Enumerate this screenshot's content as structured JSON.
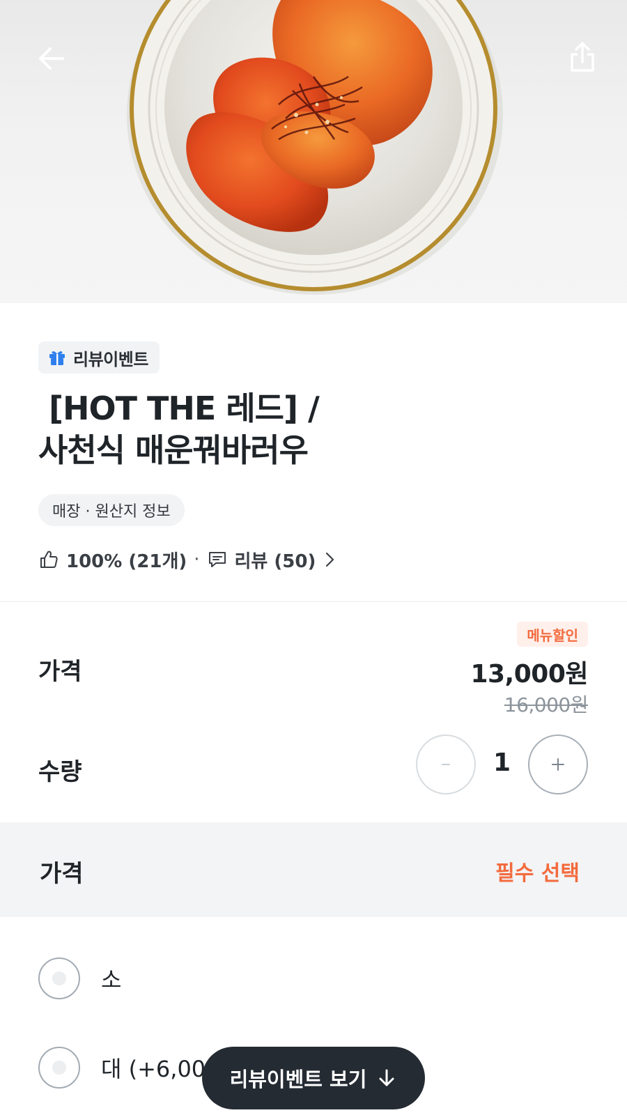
{
  "hero": {
    "image": "spicy-fried-pork-dish-photo",
    "back_icon": "arrow-left-icon",
    "share_icon": "share-icon"
  },
  "menu": {
    "event_badge": "리뷰이벤트",
    "event_icon": "gift-icon",
    "title": " [HOT THE 레드] /\n사천식 매운꿔바러우",
    "origin_info": "매장 · 원산지 정보",
    "rating": "100% (21개)",
    "separator": "·",
    "reviews": "리뷰 (50)"
  },
  "price": {
    "label": "가격",
    "discount_badge": "메뉴할인",
    "current": "13,000원",
    "original": "16,000원"
  },
  "quantity": {
    "label": "수량",
    "value": "1"
  },
  "options": {
    "title": "가격",
    "required": "필수 선택",
    "items": [
      {
        "label": "소"
      },
      {
        "label": "대 (+6,000원)"
      }
    ]
  },
  "floating_button": {
    "label": "리뷰이벤트 보기"
  },
  "colors": {
    "accent": "#f36b3e",
    "dark": "#252b33",
    "gift": "#2f80ed"
  }
}
